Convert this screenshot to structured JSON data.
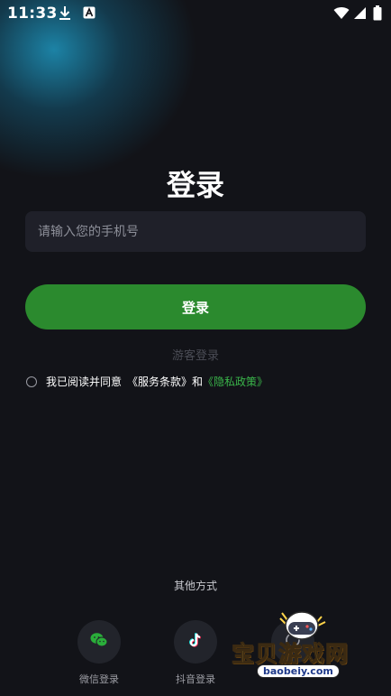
{
  "status_bar": {
    "time": "11:33"
  },
  "page": {
    "title": "登录",
    "phone_placeholder": "请输入您的手机号",
    "login_button": "登录",
    "guest_login": "游客登录"
  },
  "agreement": {
    "prefix": "我已阅读并同意",
    "terms": "《服务条款》",
    "and": "和",
    "privacy": "《隐私政策》"
  },
  "other_login": {
    "heading": "其他方式",
    "methods": [
      {
        "label": "微信登录",
        "icon": "wechat-icon"
      },
      {
        "label": "抖音登录",
        "icon": "douyin-icon"
      },
      {
        "label": "",
        "icon": "other-login-icon"
      }
    ]
  },
  "watermark": {
    "brand": "宝贝游戏网",
    "url": "baobeiy.com"
  },
  "colors": {
    "background": "#121318",
    "accent_green": "#2b8a2e",
    "privacy_link": "#3ab54a"
  }
}
